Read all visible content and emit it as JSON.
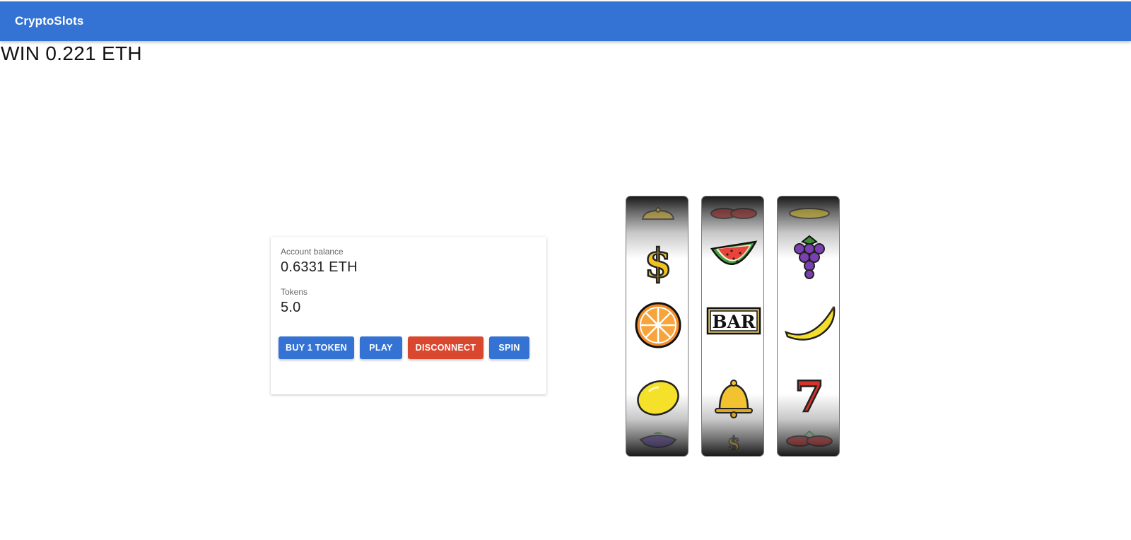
{
  "app": {
    "title": "CryptoSlots"
  },
  "win_message": "WIN 0.221 ETH",
  "account": {
    "balance_label": "Account balance",
    "balance_value": "0.6331 ETH",
    "tokens_label": "Tokens",
    "tokens_value": "5.0"
  },
  "buttons": {
    "buy": "BUY 1 TOKEN",
    "play": "PLAY",
    "disconnect": "DISCONNECT",
    "spin": "SPIN"
  },
  "colors": {
    "primary": "#3473d3",
    "danger": "#d9472e"
  },
  "reels": [
    {
      "symbols": [
        "bell-icon",
        "dollar-icon",
        "orange-icon",
        "lemon-icon",
        "grapes-icon"
      ]
    },
    {
      "symbols": [
        "cherries-icon",
        "watermelon-icon",
        "bar-icon",
        "bell-icon",
        "dollar-icon"
      ]
    },
    {
      "symbols": [
        "lemon-icon",
        "grapes-icon",
        "banana-icon",
        "seven-icon",
        "cherries-icon"
      ]
    }
  ],
  "bar_symbol_text": "BAR",
  "seven_symbol_text": "7"
}
